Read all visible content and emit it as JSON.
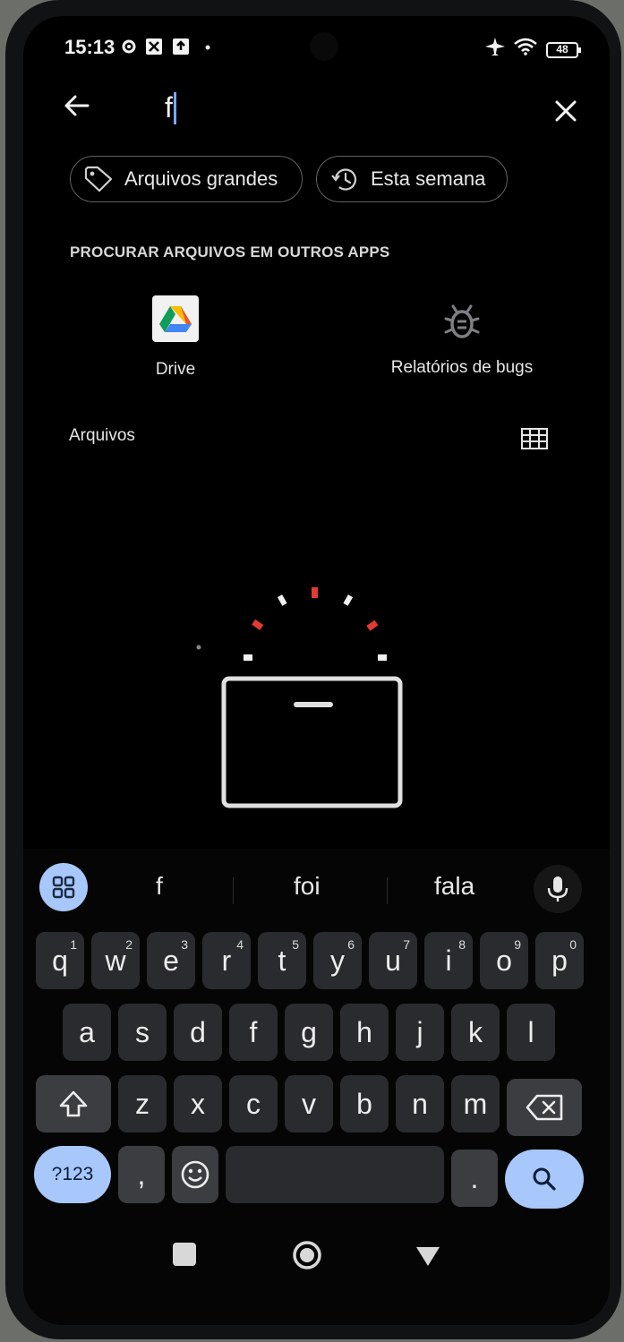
{
  "status_bar": {
    "time": "15:13",
    "battery": "48",
    "icons": [
      "settings-gear-icon",
      "crossed-box-icon",
      "upload-box-icon",
      "dot-icon",
      "airplane-icon",
      "wifi-icon",
      "battery-icon"
    ]
  },
  "search": {
    "query": "f",
    "back_icon": "arrow-left-icon",
    "close_icon": "close-icon"
  },
  "chips": [
    {
      "label": "Arquivos grandes",
      "icon": "tag-icon"
    },
    {
      "label": "Esta semana",
      "icon": "history-clock-icon"
    }
  ],
  "other_apps": {
    "title": "PROCURAR ARQUIVOS EM OUTROS APPS",
    "apps": [
      {
        "label": "Drive",
        "icon": "google-drive-icon"
      },
      {
        "label": "Relatórios de bugs",
        "icon": "bug-icon"
      }
    ]
  },
  "files": {
    "title": "Arquivos",
    "view_icon": "grid-view-icon"
  },
  "keyboard": {
    "suggestions": [
      "f",
      "foi",
      "fala"
    ],
    "row1": [
      {
        "k": "q",
        "n": "1"
      },
      {
        "k": "w",
        "n": "2"
      },
      {
        "k": "e",
        "n": "3"
      },
      {
        "k": "r",
        "n": "4"
      },
      {
        "k": "t",
        "n": "5"
      },
      {
        "k": "y",
        "n": "6"
      },
      {
        "k": "u",
        "n": "7"
      },
      {
        "k": "i",
        "n": "8"
      },
      {
        "k": "o",
        "n": "9"
      },
      {
        "k": "p",
        "n": "0"
      }
    ],
    "row2": [
      "a",
      "s",
      "d",
      "f",
      "g",
      "h",
      "j",
      "k",
      "l"
    ],
    "row3": [
      "z",
      "x",
      "c",
      "v",
      "b",
      "n",
      "m"
    ],
    "symbols_label": "?123",
    "comma": ",",
    "period": ".",
    "accent_color": "#a8c7fa"
  },
  "nav_bar": {
    "icons": [
      "square-recents-icon",
      "circle-home-icon",
      "triangle-back-icon"
    ]
  }
}
